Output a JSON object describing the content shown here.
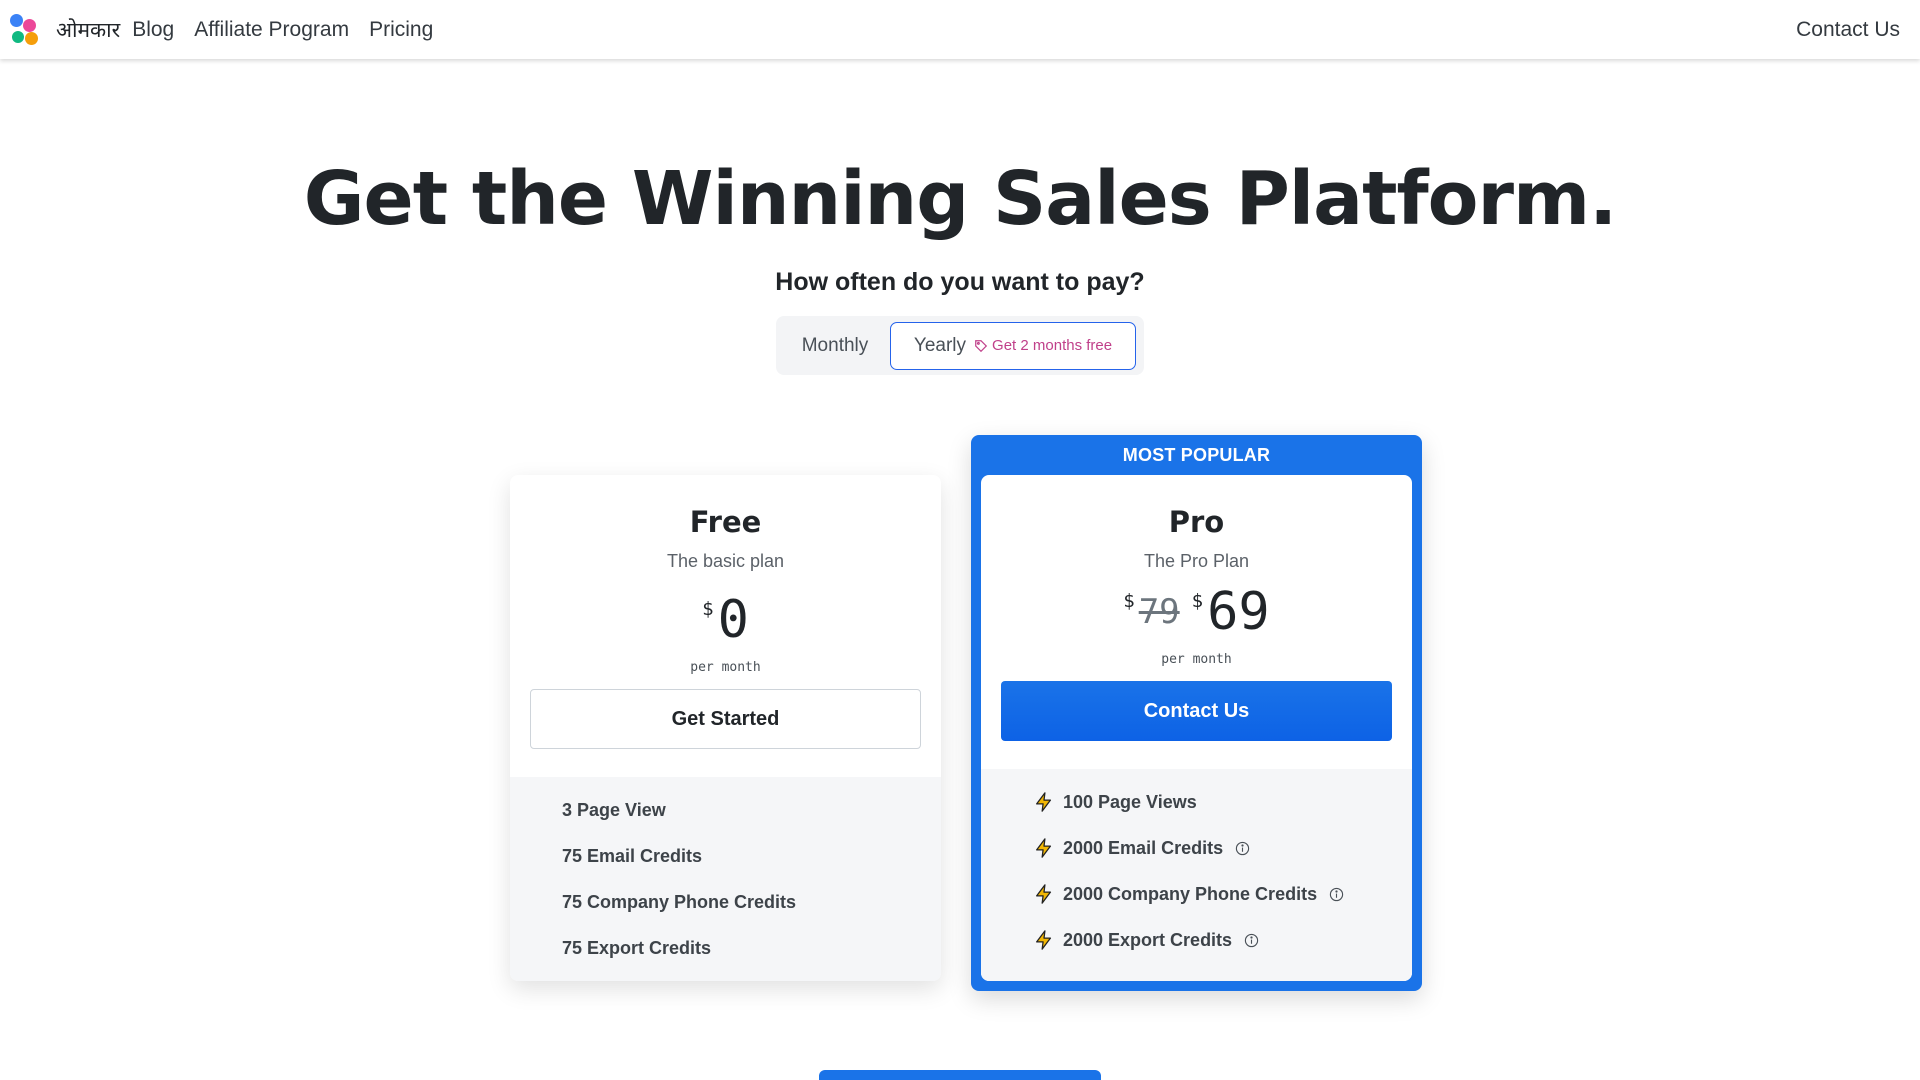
{
  "nav": {
    "brand": "ओमकार",
    "links": [
      "Blog",
      "Affiliate Program",
      "Pricing"
    ],
    "contact": "Contact Us"
  },
  "hero": {
    "title": "Get the Winning Sales Platform.",
    "subtitle": "How often do you want to pay?",
    "toggle": {
      "monthly": "Monthly",
      "yearly": "Yearly",
      "promo": "Get 2 months free",
      "selected": "Yearly"
    }
  },
  "plans": {
    "free": {
      "name": "Free",
      "desc": "The basic plan",
      "currency": "$",
      "price": "0",
      "per": "per month",
      "cta": "Get Started",
      "features": [
        "3 Page View",
        "75 Email Credits",
        "75 Company Phone Credits",
        "75 Export Credits"
      ]
    },
    "pro": {
      "ribbon": "MOST POPULAR",
      "name": "Pro",
      "desc": "The Pro Plan",
      "currency": "$",
      "old_price": "79",
      "price": "69",
      "per": "per month",
      "cta": "Contact Us",
      "features": [
        "100 Page Views",
        "2000 Email Credits",
        "2000 Company Phone Credits",
        "2000 Export Credits"
      ]
    }
  },
  "colors": {
    "accent": "#1a73e8",
    "promo": "#c0408a",
    "bolt": "#f2b705"
  }
}
